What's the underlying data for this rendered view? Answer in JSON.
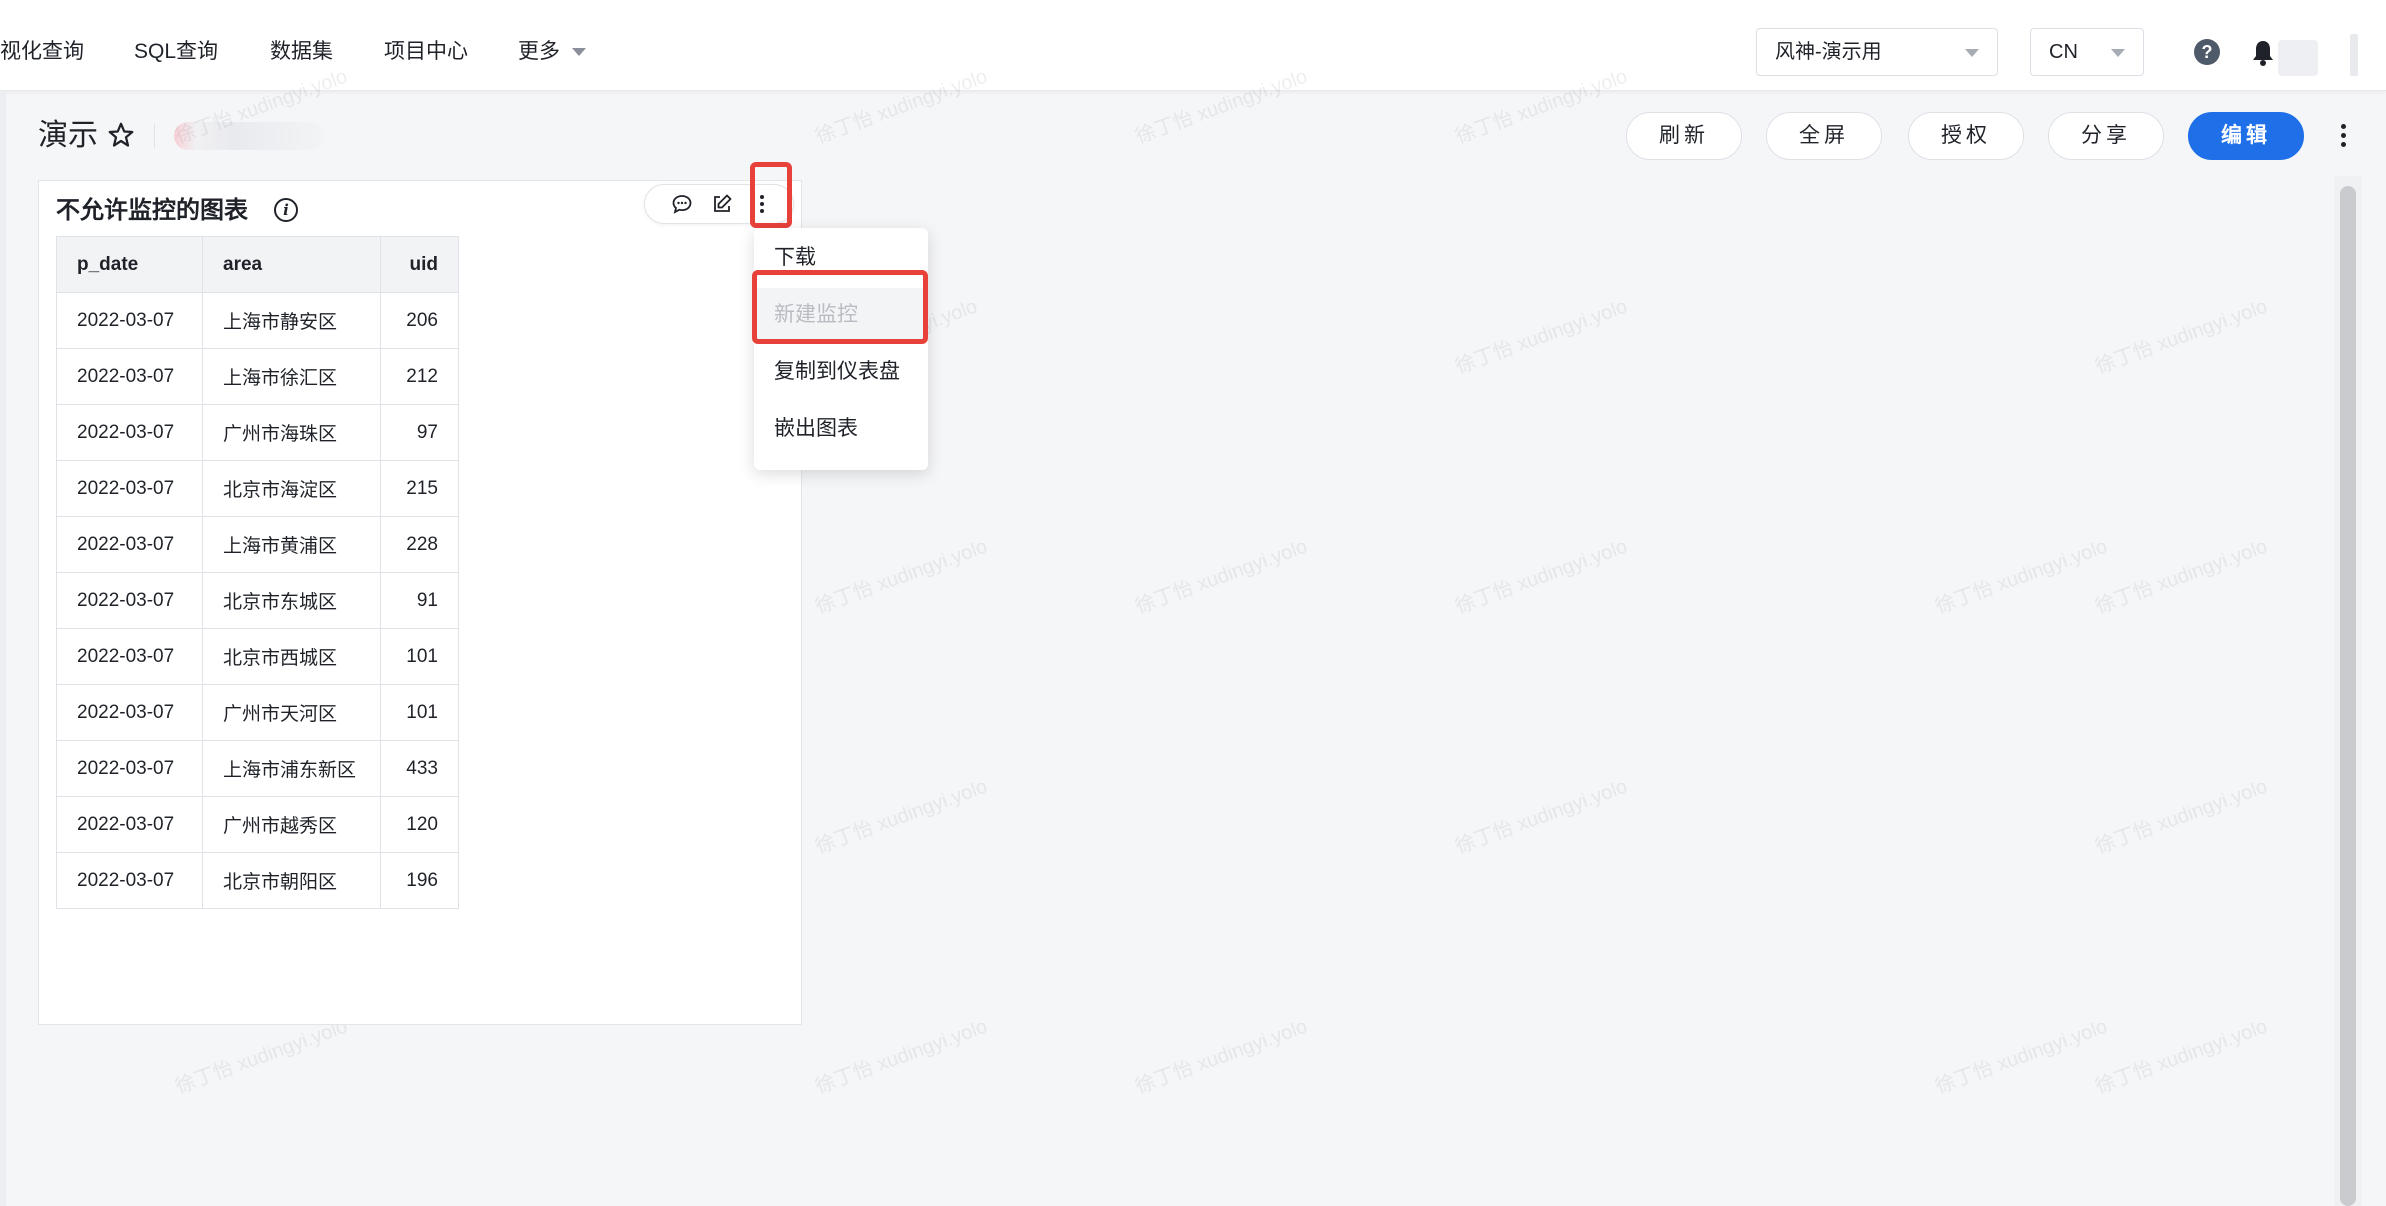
{
  "nav": {
    "items": [
      "视化查询",
      "SQL查询",
      "数据集",
      "项目中心"
    ],
    "more_label": "更多",
    "workspace_select": "风神-演示用",
    "lang_select": "CN"
  },
  "page": {
    "title": "演示",
    "buttons": {
      "refresh": "刷新",
      "fullscreen": "全屏",
      "authorize": "授权",
      "share": "分享",
      "edit": "编辑"
    }
  },
  "card": {
    "title": "不允许监控的图表",
    "table": {
      "columns": [
        "p_date",
        "area",
        "uid"
      ],
      "rows": [
        [
          "2022-03-07",
          "上海市静安区",
          "206"
        ],
        [
          "2022-03-07",
          "上海市徐汇区",
          "212"
        ],
        [
          "2022-03-07",
          "广州市海珠区",
          "97"
        ],
        [
          "2022-03-07",
          "北京市海淀区",
          "215"
        ],
        [
          "2022-03-07",
          "上海市黄浦区",
          "228"
        ],
        [
          "2022-03-07",
          "北京市东城区",
          "91"
        ],
        [
          "2022-03-07",
          "北京市西城区",
          "101"
        ],
        [
          "2022-03-07",
          "广州市天河区",
          "101"
        ],
        [
          "2022-03-07",
          "上海市浦东新区",
          "433"
        ],
        [
          "2022-03-07",
          "广州市越秀区",
          "120"
        ],
        [
          "2022-03-07",
          "北京市朝阳区",
          "196"
        ]
      ]
    }
  },
  "menu": {
    "items": [
      {
        "label": "下载",
        "disabled": false
      },
      {
        "label": "新建监控",
        "disabled": true
      },
      {
        "label": "复制到仪表盘",
        "disabled": false
      },
      {
        "label": "嵌出图表",
        "disabled": false
      }
    ]
  },
  "watermark": "徐丁怡 xudingyi.yolo",
  "colors": {
    "primary": "#1f6fe8",
    "highlight": "#e8413a"
  }
}
